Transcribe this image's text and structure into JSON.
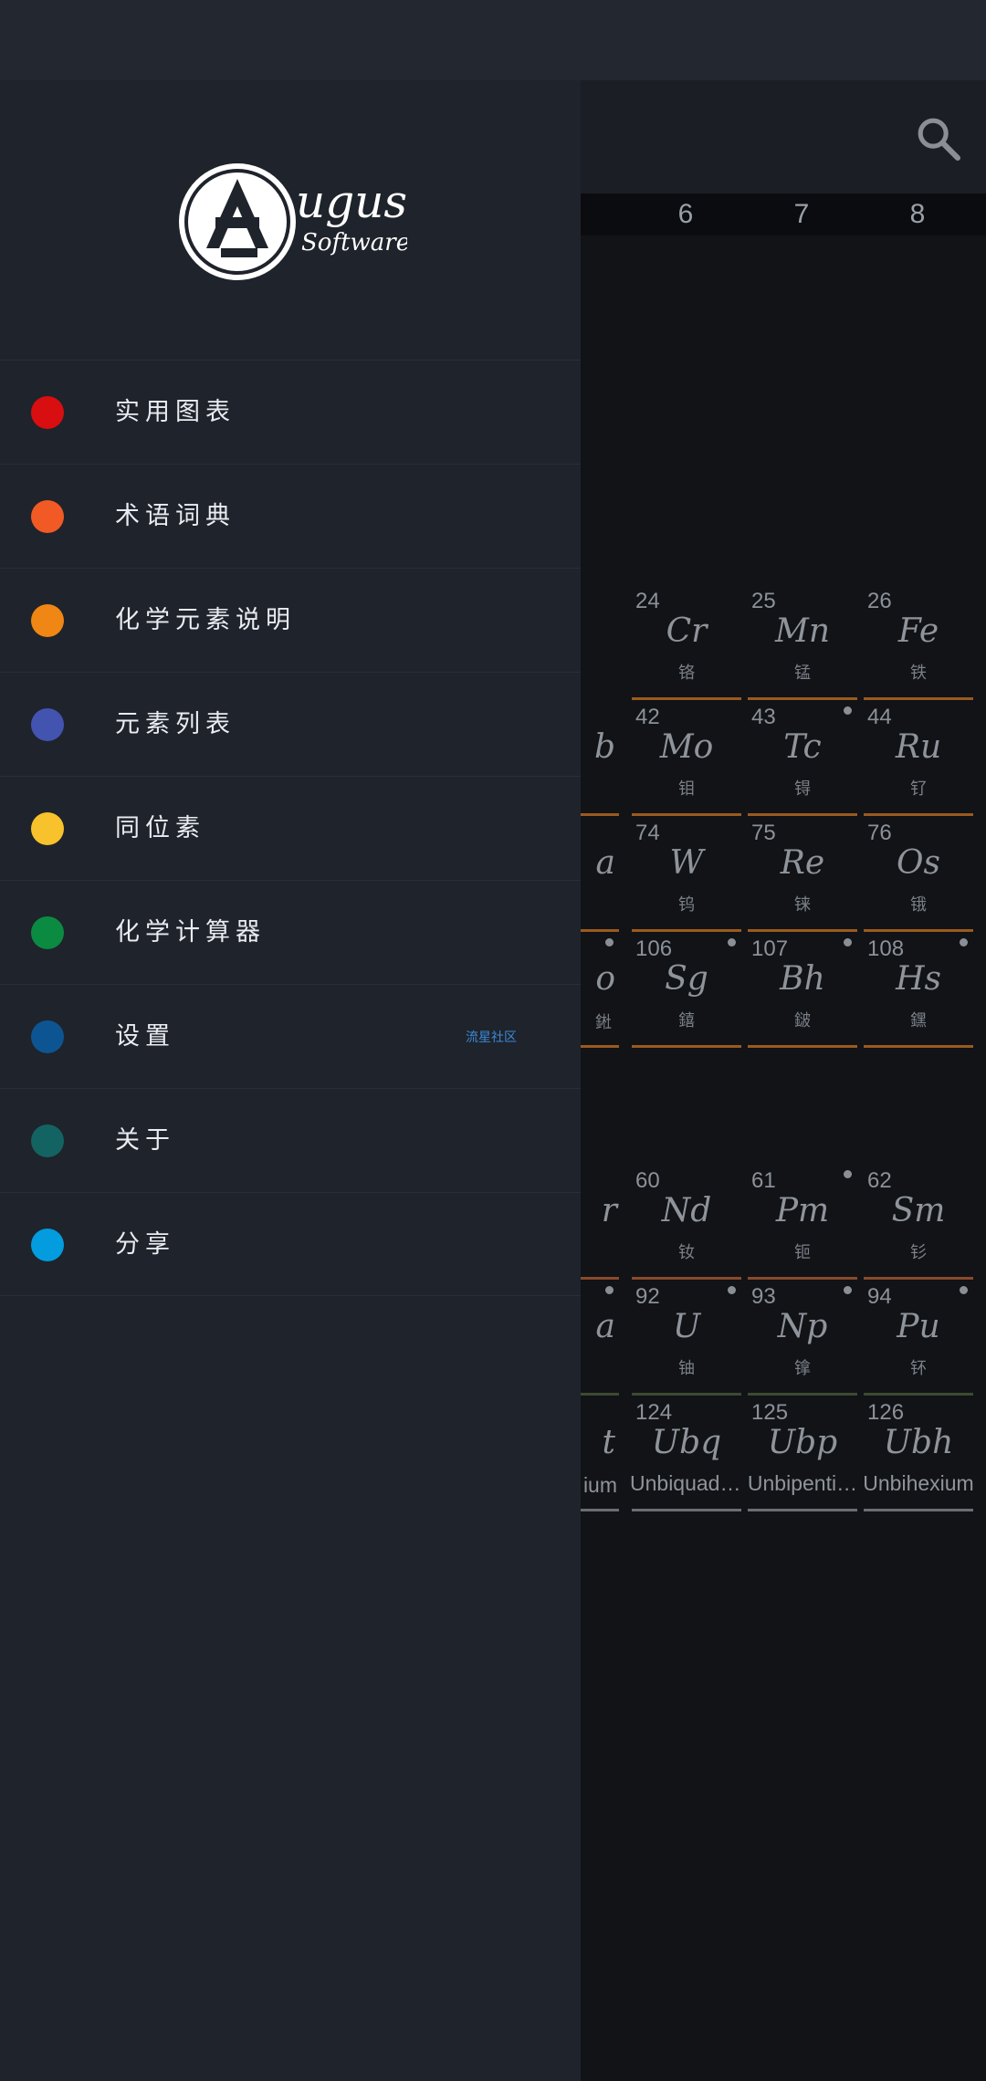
{
  "drawer": {
    "logo_title": "ugust",
    "logo_subtitle": "Software",
    "items": [
      {
        "label": "实用图表",
        "color": "#d90e10"
      },
      {
        "label": "术语词典",
        "color": "#f15a24"
      },
      {
        "label": "化学元素说明",
        "color": "#f08613"
      },
      {
        "label": "元素列表",
        "color": "#4254b0"
      },
      {
        "label": "同位素",
        "color": "#f7c22b"
      },
      {
        "label": "化学计算器",
        "color": "#0b8a42"
      },
      {
        "label": "设置",
        "color": "#0d5592",
        "badge": "流星社区"
      },
      {
        "label": "关于",
        "color": "#136362"
      },
      {
        "label": "分享",
        "color": "#029cdf"
      }
    ]
  },
  "background": {
    "icons": {
      "search": "search-icon"
    },
    "group_numbers": [
      "6",
      "7",
      "8"
    ],
    "rows": [
      {
        "bar_color": "#9a5a1e",
        "cells": [
          {
            "num": "24",
            "sym": "Cr",
            "name": "铬",
            "dot": false
          },
          {
            "num": "25",
            "sym": "Mn",
            "name": "锰",
            "dot": false
          },
          {
            "num": "26",
            "sym": "Fe",
            "name": "铁",
            "dot": false
          }
        ]
      },
      {
        "bar_color": "#9a5a1e",
        "cells": [
          {
            "num": "42",
            "sym": "Mo",
            "name": "钼",
            "dot": false
          },
          {
            "num": "43",
            "sym": "Tc",
            "name": "锝",
            "dot": true
          },
          {
            "num": "44",
            "sym": "Ru",
            "name": "钌",
            "dot": false
          }
        ]
      },
      {
        "bar_color": "#9a5a1e",
        "cells": [
          {
            "num": "74",
            "sym": "W",
            "name": "钨",
            "dot": false
          },
          {
            "num": "75",
            "sym": "Re",
            "name": "铼",
            "dot": false
          },
          {
            "num": "76",
            "sym": "Os",
            "name": "锇",
            "dot": false
          }
        ]
      },
      {
        "bar_color": "#9a5a1e",
        "cells": [
          {
            "num": "106",
            "sym": "Sg",
            "name": "𨭎",
            "dot": true
          },
          {
            "num": "107",
            "sym": "Bh",
            "name": "𨨏",
            "dot": true
          },
          {
            "num": "108",
            "sym": "Hs",
            "name": "𨭆",
            "dot": true
          }
        ]
      },
      {
        "bar_color": "#8a4a2a",
        "cells": [
          {
            "num": "60",
            "sym": "Nd",
            "name": "钕",
            "dot": false
          },
          {
            "num": "61",
            "sym": "Pm",
            "name": "钷",
            "dot": true
          },
          {
            "num": "62",
            "sym": "Sm",
            "name": "钐",
            "dot": false
          }
        ]
      },
      {
        "bar_color": "#3d4a32",
        "cells": [
          {
            "num": "92",
            "sym": "U",
            "name": "铀",
            "dot": true
          },
          {
            "num": "93",
            "sym": "Np",
            "name": "镎",
            "dot": true
          },
          {
            "num": "94",
            "sym": "Pu",
            "name": "钚",
            "dot": true
          }
        ]
      },
      {
        "bar_color": "#6a6e74",
        "cells": [
          {
            "num": "124",
            "sym": "Ubq",
            "name": "Unbiquadi…",
            "dot": false
          },
          {
            "num": "125",
            "sym": "Ubp",
            "name": "Unbipenti…",
            "dot": false
          },
          {
            "num": "126",
            "sym": "Ubh",
            "name": "Unbihexium",
            "dot": false
          }
        ]
      }
    ],
    "partial_left": {
      "r2_sym": "b",
      "r3_sym": "a",
      "r4_sym": "o",
      "r4_name": "𨧀",
      "r5_sym": "r",
      "r6_sym": "a",
      "r7_sym": "t",
      "r7_name": "ium"
    }
  }
}
